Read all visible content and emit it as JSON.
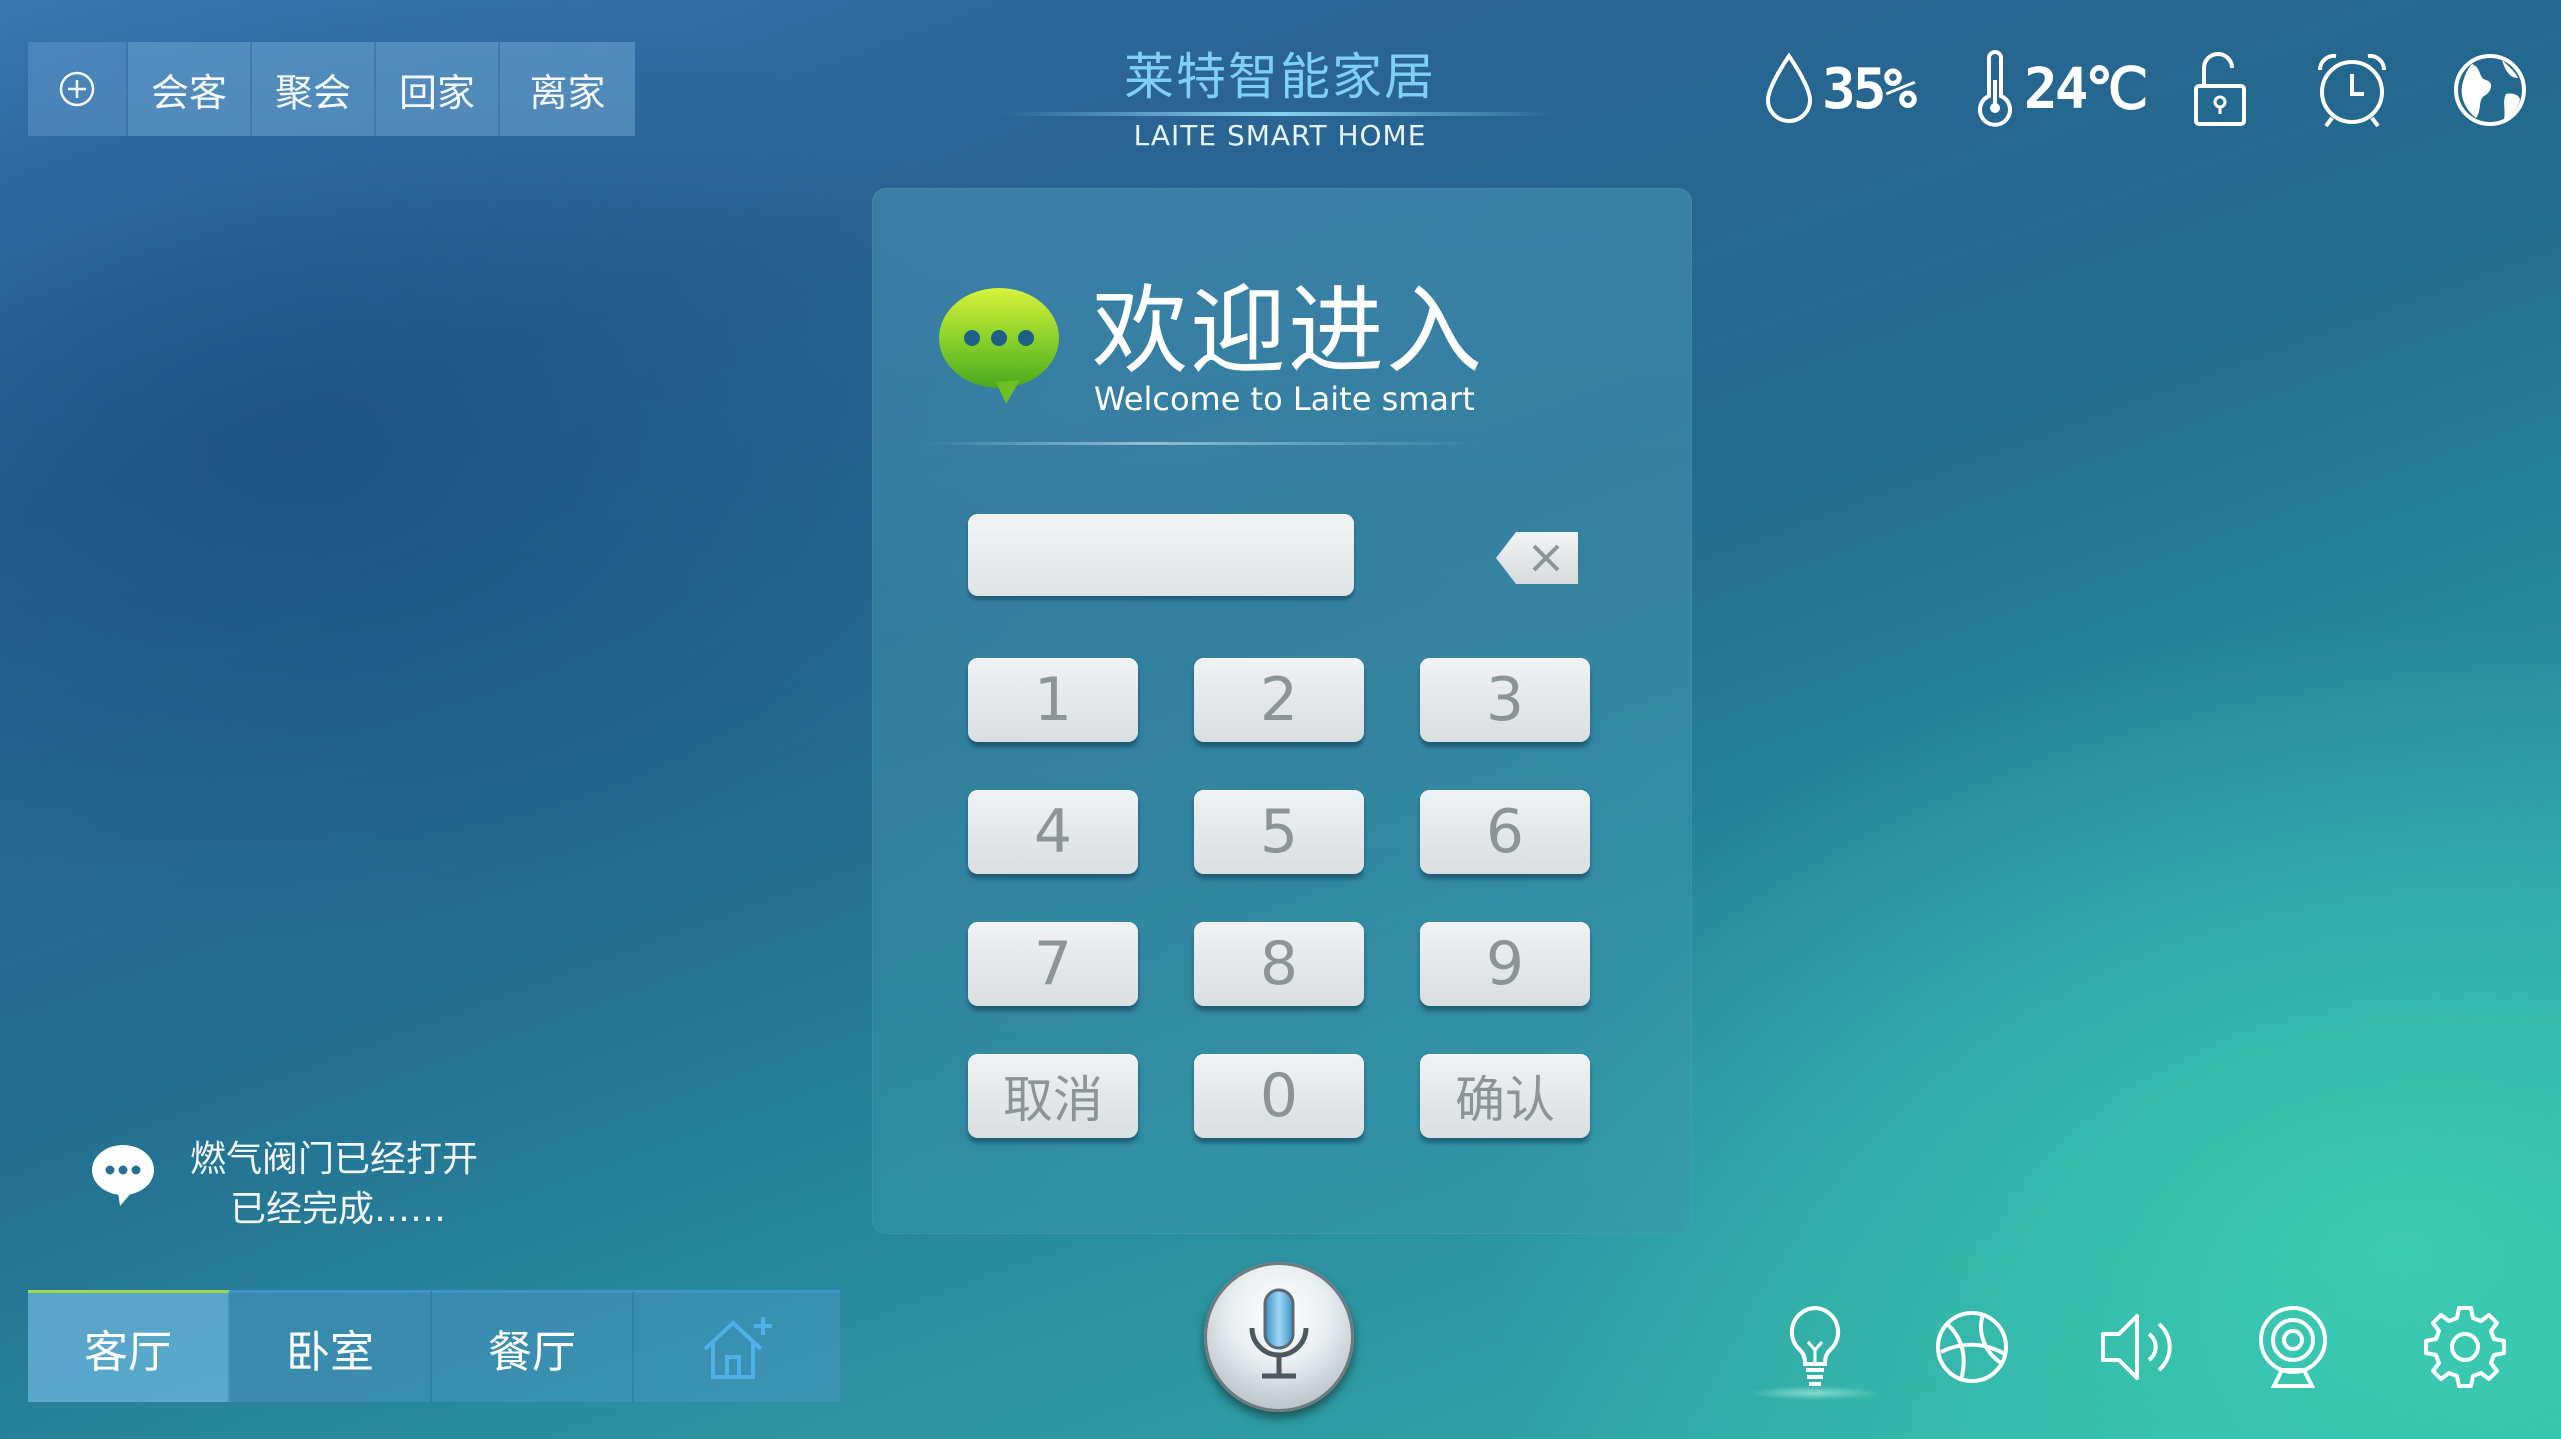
{
  "scene_tabs": {
    "add_icon": "plus-circle-icon",
    "items": [
      "会客",
      "聚会",
      "回家",
      "离家"
    ]
  },
  "brand": {
    "name_cn": "莱特智能家居",
    "name_en": "LAITE SMART HOME"
  },
  "status": {
    "humidity_icon": "water-drop-icon",
    "humidity": "35%",
    "temperature_icon": "thermometer-icon",
    "temperature": "24℃",
    "lock_icon": "unlocked-padlock-icon",
    "alarm_icon": "alarm-clock-icon",
    "globe_icon": "globe-icon"
  },
  "login": {
    "icon": "chat-bubble-icon",
    "title": "欢迎进入",
    "subtitle": "Welcome to Laite smart",
    "input_value": "",
    "backspace_icon": "backspace-icon",
    "keys": [
      "1",
      "2",
      "3",
      "4",
      "5",
      "6",
      "7",
      "8",
      "9"
    ],
    "cancel_label": "取消",
    "zero_label": "0",
    "confirm_label": "确认"
  },
  "notification": {
    "icon": "chat-bubble-icon",
    "line1": "燃气阀门已经打开",
    "line2": "已经完成……"
  },
  "rooms": {
    "items": [
      "客厅",
      "卧室",
      "餐厅"
    ],
    "active": "客厅",
    "add_icon": "add-home-icon"
  },
  "mic_icon": "microphone-icon",
  "devices": [
    "light-bulb-icon",
    "basketball-icon",
    "speaker-icon",
    "webcam-icon",
    "gear-icon"
  ],
  "colors": {
    "accent_green": "#9dd84a",
    "brand_blue": "#7fd0f5",
    "key_text": "#8d9498"
  }
}
